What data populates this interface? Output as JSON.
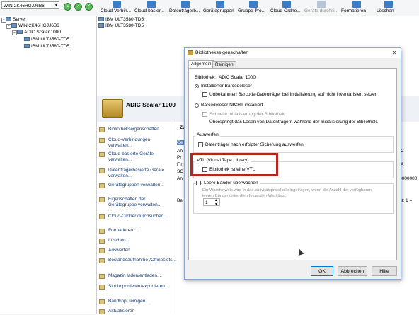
{
  "toolbar": {
    "server_select": "WIN-2K46HGJJ6B6",
    "buttons": [
      {
        "label": "Cloud-Verbin...",
        "disabled": false
      },
      {
        "label": "Cloud-basier...",
        "disabled": false
      },
      {
        "label": "Datenträgerb...",
        "disabled": false
      },
      {
        "label": "Gerätegruppen",
        "disabled": false
      },
      {
        "label": "Gruppe Pro...",
        "disabled": false
      },
      {
        "label": "Cloud-Ordne...",
        "disabled": false
      },
      {
        "label": "Geräte durchsi...",
        "disabled": true
      },
      {
        "label": "Formatieren",
        "disabled": false
      },
      {
        "label": "Löschen",
        "disabled": false
      }
    ]
  },
  "tree": {
    "root": "Server",
    "server": "WIN-2K46HGJJ6B6",
    "library": "ADIC Scalar 1000",
    "drive1": "IBM ULT3580-TD5",
    "drive2": "IBM ULT3580-TD5"
  },
  "list": {
    "item1": "IBM ULT3580-TD5",
    "item2": "IBM ULT3580-TD5"
  },
  "panel": {
    "title": "ADIC Scalar 1000",
    "actions": [
      "Bibliothekseigenschaften...",
      "Cloud-Verbindungen verwalten...",
      "Cloud-basierte Geräte verwalten...",
      "Datenträgerbasierte Geräte verwalten...",
      "Gerätegruppen verwalten...",
      "Eigenschaften der Gerätegruppe verwalten...",
      "Cloud-Ordner durchsuchen...",
      "Formatieren...",
      "Löschen...",
      "Auswerfen",
      "Bestandsaufnahme-/Offineslots...",
      "Magazin laden/entladen...",
      "Slot importieren/exportieren...",
      "Bandkopf reinigen...",
      "Aktualisieren"
    ],
    "grid_fragments": {
      "zu": "Zu",
      "ge": "Ge",
      "an": "An",
      "pr": "Pr",
      "fir": "Fir",
      "sc": "SC",
      "an2": "An",
      "be": "Be",
      "c": "C",
      "a": "A",
      "zeros": "0000000",
      "status": "ät: 1 ="
    }
  },
  "dialog": {
    "title": "Bibliothekseigenschaften",
    "close": "✕",
    "tabs": [
      "Allgemein",
      "Reinigen"
    ],
    "library_label": "Bibliothek:",
    "library_value": "ADIC Scalar 1000",
    "radio_installed": "Installierter Barcodeleser",
    "chk_unknown_barcode": "Unbekannten Barcode-Datenträger bei Initialisierung auf nicht inventarisiert setzen",
    "radio_not_installed": "Barcodeleser NICHT installiert",
    "chk_fast_init": "Schnelle Initialisierung der Bibliothek",
    "skip_note": "Überspringt das Lesen von Datenträgern während der Initialisierung der Bibliothek.",
    "group_eject": "Auswerfen",
    "chk_eject": "Datenträger nach erfolgter Sicherung auswerfen",
    "group_vtl": "VTL (Virtual Tape Library)",
    "chk_vtl": "Bibliothek ist eine VTL",
    "chk_empty_tapes": "Leere Bänder überwachen",
    "empty_note_1": "Ein Warnhinweis wird in das Aktivitätsprotokoll eingetragen, wenn die Anzahl der verfügbaren",
    "empty_note_2": "leeren Bänder unter dem folgenden Wert liegt:",
    "spin_value": "1",
    "ok": "OK",
    "cancel": "Abbrechen",
    "help": "Hilfe"
  }
}
